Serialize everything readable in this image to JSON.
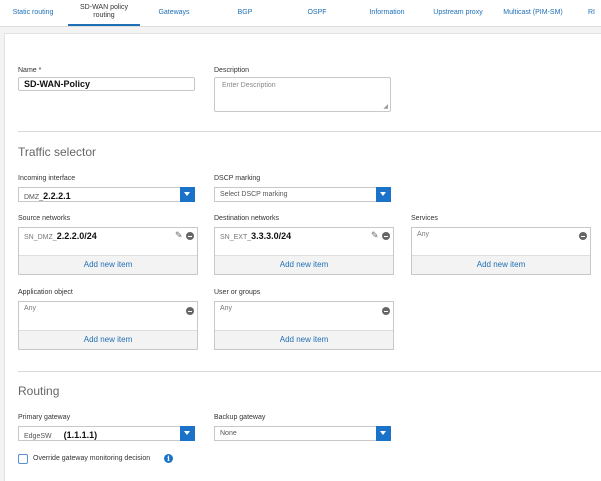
{
  "tabs": [
    {
      "label": "Static routing"
    },
    {
      "label_line1": "SD-WAN policy",
      "label_line2": "routing",
      "active": true
    },
    {
      "label": "Gateways"
    },
    {
      "label": "BGP"
    },
    {
      "label": "OSPF"
    },
    {
      "label": "Information"
    },
    {
      "label": "Upstream proxy"
    },
    {
      "label": "Multicast (PIM-SM)"
    },
    {
      "label": "RI"
    }
  ],
  "form": {
    "name_label": "Name *",
    "name_value": "SD-WAN-Policy",
    "description_label": "Description",
    "description_placeholder": "Enter Description"
  },
  "traffic": {
    "title": "Traffic selector",
    "incoming_label": "Incoming interface",
    "incoming_prefix": "DMZ_",
    "incoming_value": "2.2.2.1",
    "dscp_label": "DSCP marking",
    "dscp_value": "Select DSCP marking",
    "source_label": "Source networks",
    "source_prefix": "SN_DMZ_",
    "source_value": "2.2.2.0/24",
    "dest_label": "Destination networks",
    "dest_prefix": "SN_EXT_",
    "dest_value": "3.3.3.0/24",
    "services_label": "Services",
    "services_value": "Any",
    "app_label": "Application object",
    "app_value": "Any",
    "users_label": "User or groups",
    "users_value": "Any",
    "add_new_item": "Add new item"
  },
  "routing": {
    "title": "Routing",
    "primary_label": "Primary gateway",
    "primary_prefix": "EdgeSW",
    "primary_value": "(1.1.1.1)",
    "backup_label": "Backup gateway",
    "backup_value": "None",
    "override_label": "Override gateway monitoring decision"
  },
  "icons": {
    "dropdown": "chevron-down-icon",
    "remove": "minus-circle-icon",
    "edit": "pencil-icon",
    "info": "info-icon"
  },
  "colors": {
    "accent": "#1a73c8",
    "link": "#1f6fb5"
  }
}
